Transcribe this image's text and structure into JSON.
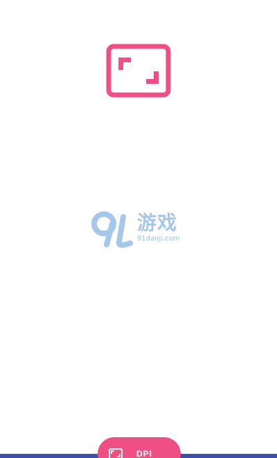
{
  "colors": {
    "accent": "#ee4f84",
    "bar": "#3f4fa6",
    "watermark": "#a6c6ea"
  },
  "hero": {
    "icon": "aspect-ratio-icon"
  },
  "watermark": {
    "brand_number": "91",
    "brand_text": "游戏",
    "site": "91danji.com"
  },
  "fab": {
    "icon": "aspect-ratio-icon",
    "label": "DPI"
  }
}
